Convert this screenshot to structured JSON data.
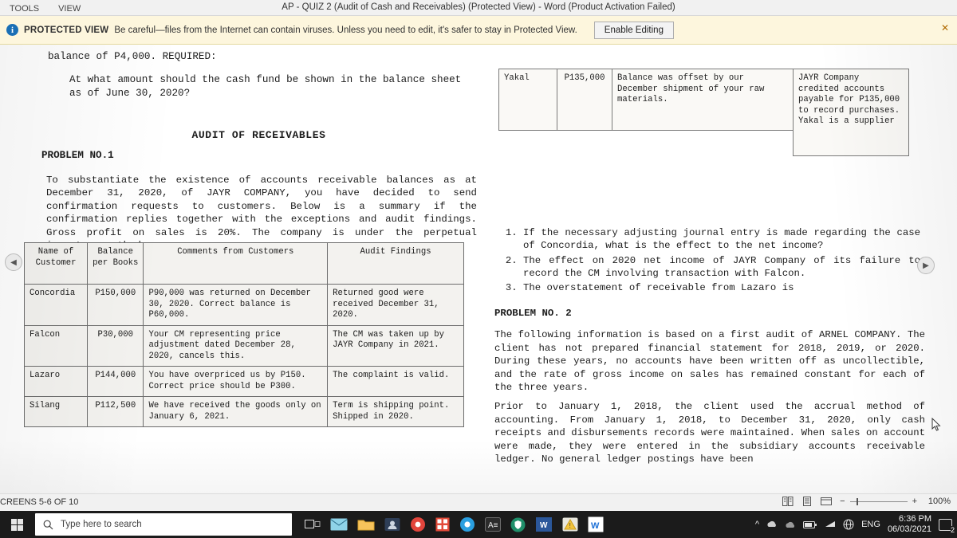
{
  "window": {
    "ribbon_tabs": [
      "TOOLS",
      "VIEW"
    ],
    "title": "AP - QUIZ 2 (Audit of Cash and Receivables)  (Protected View) - Word (Product Activation Failed)",
    "controls": {
      "help": "⛶",
      "minimize": "—",
      "restore": "⊟",
      "close": "✕"
    }
  },
  "protected_view": {
    "icon": "info-icon",
    "label": "PROTECTED VIEW",
    "message": "Be careful—files from the Internet can contain viruses. Unless you need to edit, it's safer to stay in Protected View.",
    "button": "Enable Editing",
    "close": "✕"
  },
  "document": {
    "left": {
      "balance_line": "balance of P4,000.  REQUIRED:",
      "required_text": "At what amount should the cash fund be shown in the balance sheet as of June  30, 2020?",
      "section_heading": "AUDIT OF RECEIVABLES",
      "problem_label": "PROBLEM NO.1",
      "problem_text": "To substantiate the existence of accounts receivable balances as at December 31,  2020, of JAYR COMPANY, you have decided to send confirmation requests to  customers. Below is a summary if the confirmation replies together with the  exceptions and audit findings. Gross profit on sales is 20%. The company is under  the perpetual inventory method.",
      "table": {
        "headers": [
          "Name of Customer",
          "Balance per Books",
          "Comments from Customers",
          "Audit Findings"
        ],
        "rows": [
          {
            "name": "Concordia",
            "balance": "P150,000",
            "comments": "P90,000 was returned on December 30, 2020. Correct balance is P60,000.",
            "findings": "Returned good were received December 31, 2020."
          },
          {
            "name": "Falcon",
            "balance": "P30,000",
            "comments": "Your CM representing price adjustment dated December 28, 2020, cancels this.",
            "findings": "The CM was taken up by JAYR Company in 2021."
          },
          {
            "name": "Lazaro",
            "balance": "P144,000",
            "comments": "You have overpriced us by P150. Correct price should be P300.",
            "findings": "The complaint is valid."
          },
          {
            "name": "Silang",
            "balance": "P112,500",
            "comments": "We have received the goods only on January 6, 2021.",
            "findings": "Term is shipping point. Shipped in 2020."
          }
        ]
      }
    },
    "right": {
      "row_name": "Yakal",
      "row_amount": "P135,000",
      "row_comment": "Balance was offset by our December shipment of your raw materials.",
      "row_finding": "JAYR Company credited accounts payable for P135,000 to record purchases. Yakal is a supplier",
      "questions": [
        "If the necessary adjusting journal entry is made regarding the case of Concordia, what is the effect to the net income?",
        "The effect on 2020 net income of JAYR Company of its failure to record the  CM involving transaction with Falcon.",
        "The overstatement of receivable from Lazaro is"
      ],
      "problem2_label": "PROBLEM NO. 2",
      "problem2_text": "The following information is based on a first audit of ARNEL COMPANY. The client  has not prepared financial statement for 2018, 2019, or 2020. During these years,  no accounts have been written off as uncollectible, and the rate of gross income on sales has remained constant for each of the three years.",
      "problem2_text2": "Prior to January 1, 2018, the client used the accrual method of accounting. From  January 1, 2018, to December 31, 2020, only cash receipts and disbursements  records were maintained. When sales on account were made, they were entered in  the subsidiary accounts receivable ledger. No general ledger postings have been"
    },
    "nav": {
      "prev": "◀",
      "next": "▶"
    }
  },
  "status_bar": {
    "page_info": "CREENS 5-6 OF 10",
    "view_icons": [
      "read-mode-icon",
      "print-layout-icon",
      "web-layout-icon"
    ],
    "zoom_out": "−",
    "zoom_in": "+",
    "zoom_value": "100%"
  },
  "taskbar": {
    "start": "windows-logo",
    "search_placeholder": "Type here to search",
    "apps": [
      "task-view",
      "mail",
      "file-explorer",
      "user-app",
      "chrome-red",
      "calculator",
      "chrome",
      "store",
      "shield",
      "word",
      "warning-app",
      "whatsapp"
    ],
    "tray": {
      "chevron": "^",
      "icons": [
        "onedrive",
        "cloud",
        "battery",
        "network",
        "globe"
      ],
      "language": "ENG",
      "time": "6:36 PM",
      "date": "06/03/2021",
      "notification_count": "2"
    }
  }
}
